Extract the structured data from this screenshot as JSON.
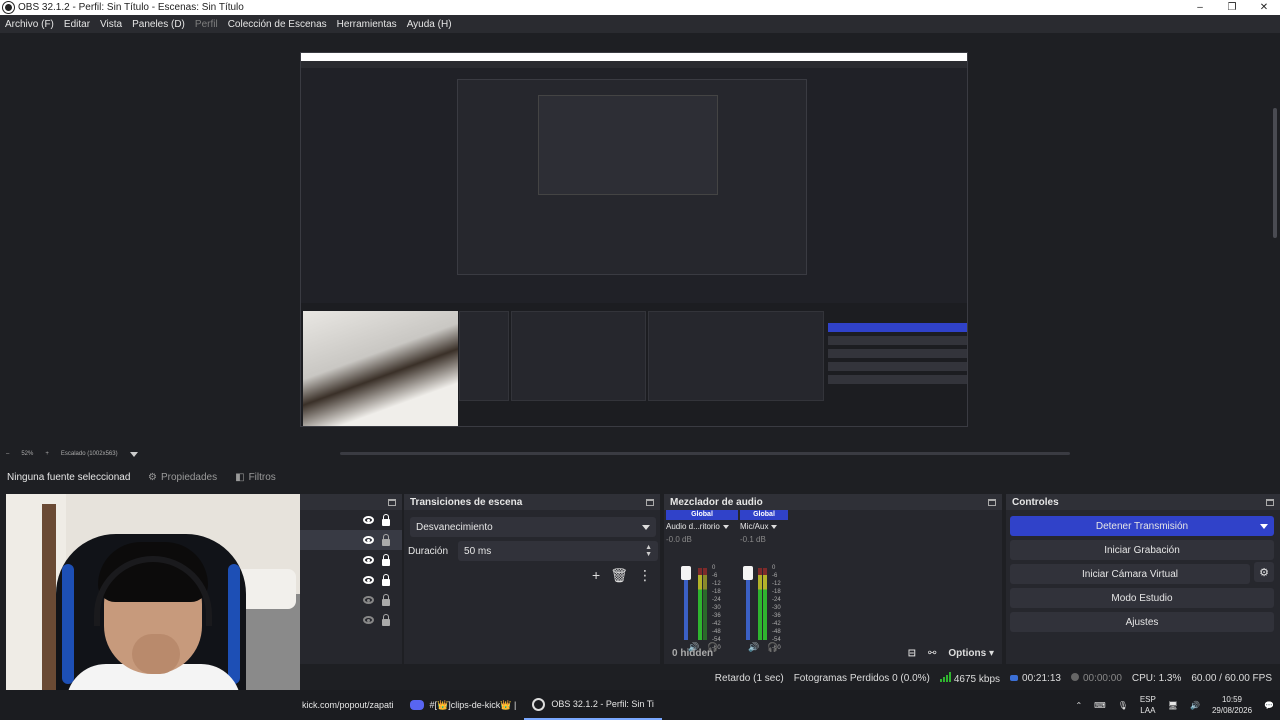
{
  "window": {
    "title": "OBS 32.1.2 - Perfil: Sin Título - Escenas: Sin Título",
    "controls": [
      "–",
      "❐",
      "✕"
    ]
  },
  "menu": [
    {
      "label": "Archivo (F)",
      "disabled": false
    },
    {
      "label": "Editar",
      "disabled": false
    },
    {
      "label": "Vista",
      "disabled": false
    },
    {
      "label": "Paneles (D)",
      "disabled": false
    },
    {
      "label": "Perfil",
      "disabled": true
    },
    {
      "label": "Colección de Escenas",
      "disabled": false
    },
    {
      "label": "Herramientas",
      "disabled": false
    },
    {
      "label": "Ayuda (H)",
      "disabled": false
    }
  ],
  "zoombar": {
    "minus": "–",
    "zoom": "52%",
    "plus": "+",
    "scaled": "Escalado (1002x563)"
  },
  "source_toolbar": {
    "no_source": "Ninguna fuente seleccionad",
    "properties": "Propiedades",
    "filters": "Filtros"
  },
  "transitions": {
    "title": "Transiciones de escena",
    "selected": "Desvanecimiento",
    "duration_label": "Duración",
    "duration_value": "50 ms"
  },
  "mixer": {
    "title": "Mezclador de audio",
    "channels": [
      {
        "badge": "Global",
        "name": "Audio d...ritorio",
        "db": "-0.0 dB"
      },
      {
        "badge": "Global",
        "name": "Mic/Aux",
        "db": "-0.1 dB"
      }
    ],
    "scale": [
      "0",
      "-6",
      "-12",
      "-18",
      "-24",
      "-30",
      "-36",
      "-42",
      "-48",
      "-54",
      "-60"
    ],
    "hidden": "0 hidden",
    "options": "Options"
  },
  "controls": {
    "title": "Controles",
    "stop_stream": "Detener Transmisión",
    "start_recording": "Iniciar Grabación",
    "start_vcam": "Iniciar Cámara Virtual",
    "studio_mode": "Modo Estudio",
    "settings": "Ajustes"
  },
  "status": {
    "delay": "Retardo (1 sec)",
    "dropped": "Fotogramas Perdidos 0 (0.0%)",
    "bitrate": "4675 kbps",
    "stream_time": "00:21:13",
    "rec_time": "00:00:00",
    "cpu": "CPU: 1.3%",
    "fps": "60.00 / 60.00 FPS"
  },
  "taskbar": {
    "kick": "kick.com/popout/zapati",
    "discord": "#[👑]clips-de-kick👑 |",
    "obs": "OBS 32.1.2 - Perfil: Sin Ti",
    "lang_top": "ESP",
    "lang_bottom": "LAA",
    "time": "10:59",
    "date": "29/08/2026"
  },
  "colors": {
    "accent": "#3042c9",
    "bg": "#1e1f23",
    "panel": "#26272d"
  }
}
